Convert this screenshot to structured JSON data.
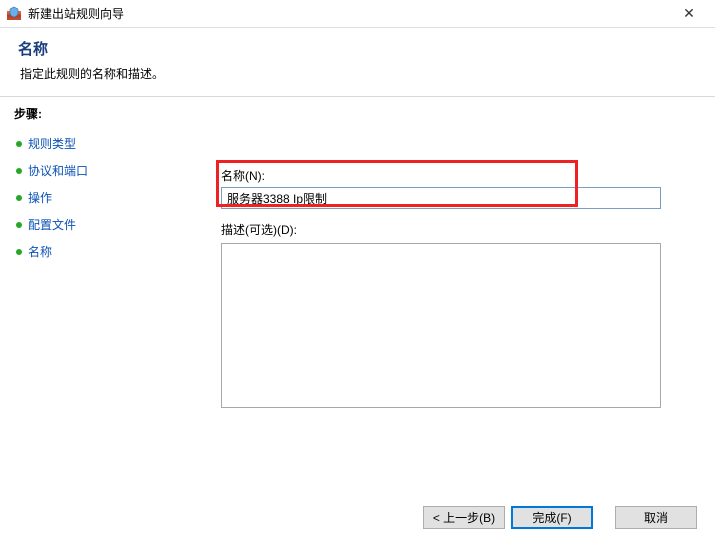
{
  "titlebar": {
    "title": "新建出站规则向导",
    "close_label": "✕"
  },
  "header": {
    "title": "名称",
    "subtitle": "指定此规则的名称和描述。"
  },
  "sidebar": {
    "steps_label": "步骤:",
    "items": [
      {
        "label": "规则类型"
      },
      {
        "label": "协议和端口"
      },
      {
        "label": "操作"
      },
      {
        "label": "配置文件"
      },
      {
        "label": "名称"
      }
    ]
  },
  "main": {
    "name_label": "名称(N):",
    "name_value": "服务器3388 Ip限制",
    "desc_label": "描述(可选)(D):",
    "desc_value": ""
  },
  "footer": {
    "back_label": "< 上一步(B)",
    "finish_label": "完成(F)",
    "cancel_label": "取消"
  }
}
